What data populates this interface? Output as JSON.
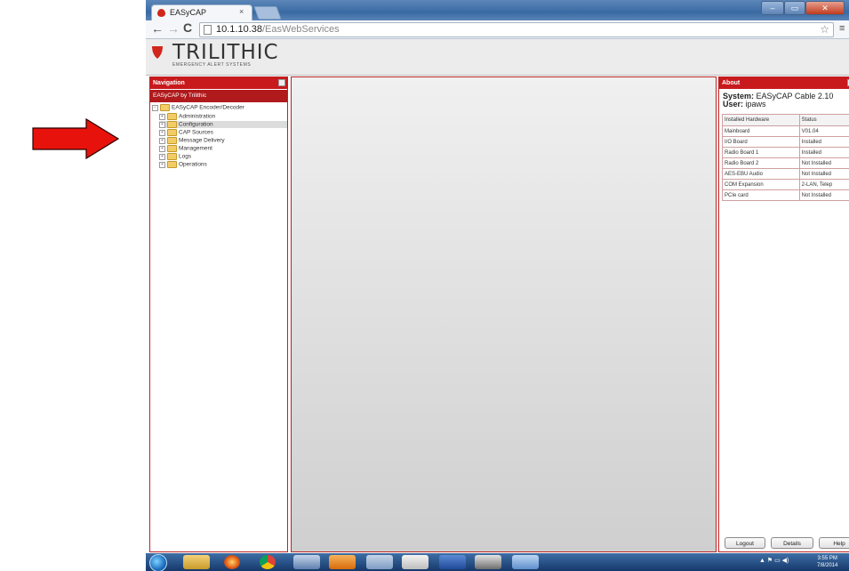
{
  "browser": {
    "tab_title": "EASyCAP",
    "tab_close": "×",
    "url_host": "10.1.10.38",
    "url_path": "/EasWebServices"
  },
  "header": {
    "logo_text": "TRILITHIC",
    "logo_subtitle": "EMERGENCY ALERT SYSTEMS"
  },
  "navigation": {
    "panel_title": "Navigation",
    "subheader": "EASyCAP by Trilithic",
    "root": "EASyCAP Encoder/Decoder",
    "items": [
      {
        "label": "Administration"
      },
      {
        "label": "Configuration"
      },
      {
        "label": "CAP Sources"
      },
      {
        "label": "Message Delivery"
      },
      {
        "label": "Management"
      },
      {
        "label": "Logs"
      },
      {
        "label": "Operations"
      }
    ]
  },
  "about": {
    "panel_title": "About",
    "system_label": "System:",
    "system_value": "EASyCAP Cable  2.10",
    "user_label": "User:",
    "user_value": "ipaws",
    "table_headers": [
      "Installed Hardware",
      "Status"
    ],
    "rows": [
      [
        "Mainboard",
        "V01.04"
      ],
      [
        "I/O Board",
        "Installed"
      ],
      [
        "Radio Board 1",
        "Installed"
      ],
      [
        "Radio Board 2",
        "Not Installed"
      ],
      [
        "AES-EBU Audio",
        "Not Installed"
      ],
      [
        "COM Expansion",
        "2-LAN, Telep"
      ],
      [
        "PCIe card",
        "Not Installed"
      ]
    ],
    "buttons": {
      "logout": "Logout",
      "details": "Details",
      "help": "Help"
    }
  },
  "taskbar": {
    "time": "3:55 PM",
    "date": "7/8/2014"
  },
  "colors": {
    "brand_red": "#c8191c",
    "arrow_red": "#e8120c"
  }
}
